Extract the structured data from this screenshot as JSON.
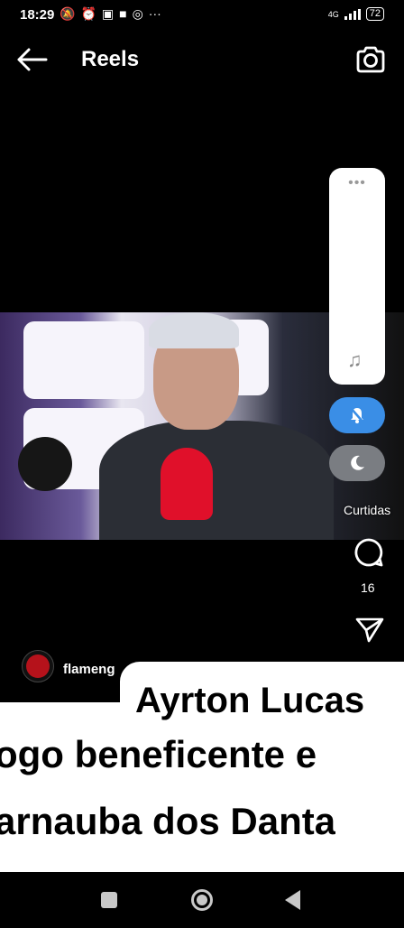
{
  "status_bar": {
    "time": "18:29",
    "network": "4G",
    "battery": "72"
  },
  "header": {
    "title": "Reels"
  },
  "actions": {
    "likes_label": "Curtidas",
    "comment_count": "16"
  },
  "post": {
    "username": "flameng"
  },
  "caption": {
    "name": "Ayrton Lucas",
    "line1": "ogo beneficente e",
    "line2": "arnauba dos Danta"
  },
  "colors": {
    "accent_blue": "#3a8ee6",
    "mic_red": "#e0102a"
  }
}
